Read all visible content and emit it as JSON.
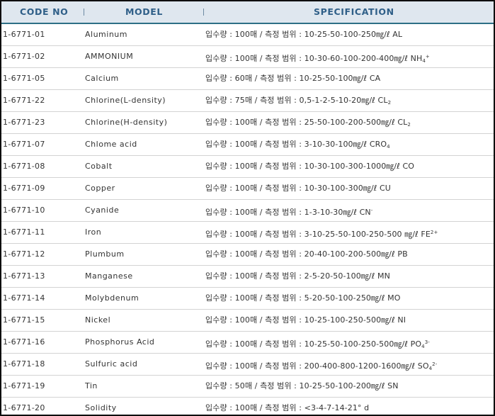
{
  "header": {
    "code_label": "CODE NO",
    "model_label": "MODEL",
    "spec_label": "SPECIFICATION"
  },
  "rows": [
    {
      "code": "1-6771-01",
      "model": "Aluminum",
      "spec": "입수량 : 100매 / 측정 범위 : 10-25-50-100-250㎎/ℓ",
      "chem": "AL",
      "sub": "",
      "sup": ""
    },
    {
      "code": "1-6771-02",
      "model": "AMMONIUM",
      "spec": "입수량 : 100매 / 측정 범위 : 10-30-60-100-200-400㎎/ℓ",
      "chem": "NH",
      "sub": "4",
      "sup": "+"
    },
    {
      "code": "1-6771-05",
      "model": "Calcium",
      "spec": "입수량 : 60매 / 측정 범위 : 10-25-50-100㎎/ℓ",
      "chem": "CA",
      "sub": "",
      "sup": ""
    },
    {
      "code": "1-6771-22",
      "model": "Chlorine(L-density)",
      "spec": "입수량 : 75매 / 측정 범위 : 0,5-1-2-5-10-20㎎/ℓ",
      "chem": "CL",
      "sub": "2",
      "sup": ""
    },
    {
      "code": "1-6771-23",
      "model": "Chlorine(H-density)",
      "spec": "입수량 : 100매 / 측정 범위 : 25-50-100-200-500㎎/ℓ",
      "chem": "CL",
      "sub": "2",
      "sup": ""
    },
    {
      "code": "1-6771-07",
      "model": "Chlome acid",
      "spec": "입수량 : 100매 / 측정 범위 : 3-10-30-100㎎/ℓ",
      "chem": "CRO",
      "sub": "4",
      "sup": ""
    },
    {
      "code": "1-6771-08",
      "model": "Cobalt",
      "spec": "입수량 : 100매 / 측정 범위 : 10-30-100-300-1000㎎/ℓ",
      "chem": "CO",
      "sub": "",
      "sup": ""
    },
    {
      "code": "1-6771-09",
      "model": "Copper",
      "spec": "입수량 : 100매 / 측정 범위 : 10-30-100-300㎎/ℓ",
      "chem": "CU",
      "sub": "",
      "sup": ""
    },
    {
      "code": "1-6771-10",
      "model": "Cyanide",
      "spec": "입수량 : 100매 / 측정 범위 : 1-3-10-30㎎/ℓ",
      "chem": "CN",
      "sub": "",
      "sup": "-"
    },
    {
      "code": "1-6771-11",
      "model": "Iron",
      "spec": "입수량 : 100매 / 측정 범위 : 3-10-25-50-100-250-500 ㎎/ℓ",
      "chem": "FE",
      "sub": "",
      "sup": "2+"
    },
    {
      "code": "1-6771-12",
      "model": "Plumbum",
      "spec": "입수량 : 100매 / 측정 범위 : 20-40-100-200-500㎎/ℓ",
      "chem": "PB",
      "sub": "",
      "sup": ""
    },
    {
      "code": "1-6771-13",
      "model": "Manganese",
      "spec": "입수량 : 100매 / 측정 범위 : 2-5-20-50-100㎎/ℓ",
      "chem": "MN",
      "sub": "",
      "sup": ""
    },
    {
      "code": "1-6771-14",
      "model": "Molybdenum",
      "spec": "입수량 : 100매 / 측정 범위 : 5-20-50-100-250㎎/ℓ",
      "chem": "MO",
      "sub": "",
      "sup": ""
    },
    {
      "code": "1-6771-15",
      "model": "Nickel",
      "spec": "입수량 : 100매 / 측정 범위 : 10-25-100-250-500㎎/ℓ",
      "chem": "NI",
      "sub": "",
      "sup": ""
    },
    {
      "code": "1-6771-16",
      "model": "Phosphorus Acid",
      "spec": "입수량 : 100매 / 측정 범위 : 10-25-50-100-250-500㎎/ℓ",
      "chem": "PO",
      "sub": "4",
      "sup": "3-"
    },
    {
      "code": "1-6771-18",
      "model": "Sulfuric acid",
      "spec": "입수량 : 100매 / 측정 범위 : 200-400-800-1200-1600㎎/ℓ",
      "chem": "SO",
      "sub": "4",
      "sup": "2-"
    },
    {
      "code": "1-6771-19",
      "model": "Tin",
      "spec": "입수량 : 50매 / 측정 범위 : 10-25-50-100-200㎎/ℓ",
      "chem": "SN",
      "sub": "",
      "sup": ""
    },
    {
      "code": "1-6771-20",
      "model": "Solidity",
      "spec": "입수량 : 100매 / 측정 범위 : <3-4-7-14-21° d",
      "chem": "",
      "sub": "",
      "sup": ""
    }
  ]
}
